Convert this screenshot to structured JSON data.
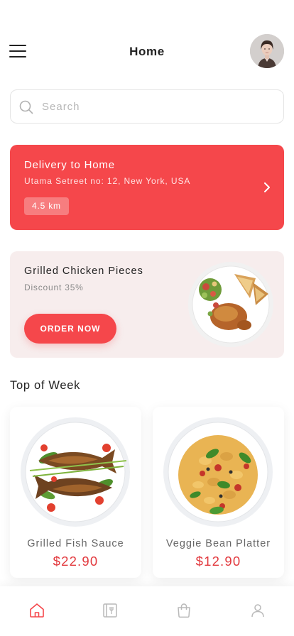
{
  "header": {
    "title": "Home",
    "menu_icon": "hamburger-menu-icon",
    "avatar": "user-avatar-photo"
  },
  "search": {
    "placeholder": "Search",
    "value": "",
    "icon": "search-icon"
  },
  "delivery": {
    "title": "Delivery to Home",
    "address": "Utama Setreet no: 12, New York, USA",
    "distance": "4.5 km",
    "icon": "chevron-right-icon"
  },
  "promo": {
    "title": "Grilled Chicken Pieces",
    "discount": "Discount 35%",
    "button_label": "ORDER NOW"
  },
  "top_of_week": {
    "title": "Top of Week",
    "items": [
      {
        "name": "Grilled Fish Sauce",
        "price": "$22.90"
      },
      {
        "name": "Veggie Bean Platter",
        "price": "$12.90"
      }
    ]
  },
  "bottom_nav": {
    "items": [
      {
        "icon": "home-icon",
        "active": true
      },
      {
        "icon": "menu-book-icon",
        "active": false
      },
      {
        "icon": "shopping-bag-icon",
        "active": false
      },
      {
        "icon": "profile-icon",
        "active": false
      }
    ]
  },
  "colors": {
    "accent": "#f5474b",
    "price": "#e2393e",
    "promo_bg": "#f7eded",
    "nav_inactive": "#b9b9b9"
  }
}
